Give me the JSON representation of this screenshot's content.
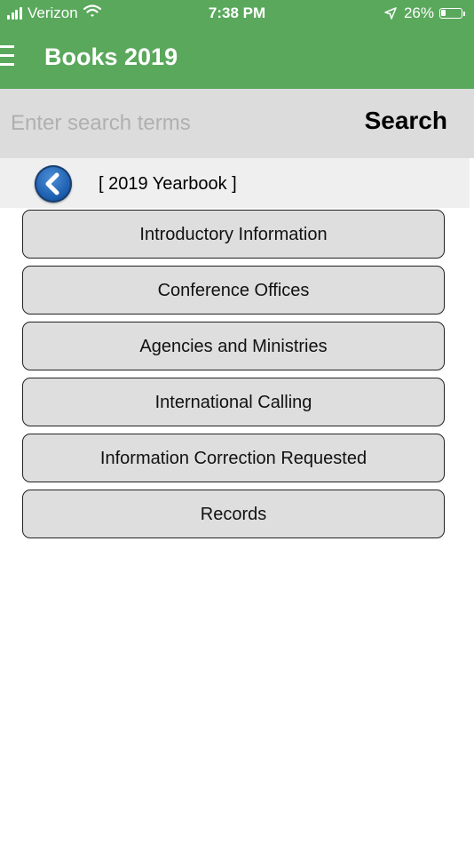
{
  "status_bar": {
    "carrier": "Verizon",
    "time": "7:38 PM",
    "battery_percent": "26%",
    "battery_level": 0.26,
    "icons": [
      "signal-icon",
      "wifi-icon",
      "location-icon",
      "battery-icon"
    ]
  },
  "header": {
    "title": "Books 2019",
    "icon": "hamburger-menu-icon"
  },
  "search": {
    "placeholder": "Enter search terms",
    "value": "",
    "button_label": "Search"
  },
  "breadcrumb": {
    "back_icon": "chevron-left-icon",
    "label": "[ 2019 Yearbook ]"
  },
  "menu": {
    "items": [
      {
        "label": "Introductory Information"
      },
      {
        "label": "Conference Offices"
      },
      {
        "label": "Agencies and Ministries"
      },
      {
        "label": "International Calling"
      },
      {
        "label": "Information Correction Requested"
      },
      {
        "label": "Records"
      }
    ]
  },
  "colors": {
    "header": "#5aa85c",
    "search_bar": "#dcdcdc",
    "breadcrumb_bar": "#efefef",
    "menu_item": "#dedede",
    "back_button": "#1d5fb0"
  }
}
